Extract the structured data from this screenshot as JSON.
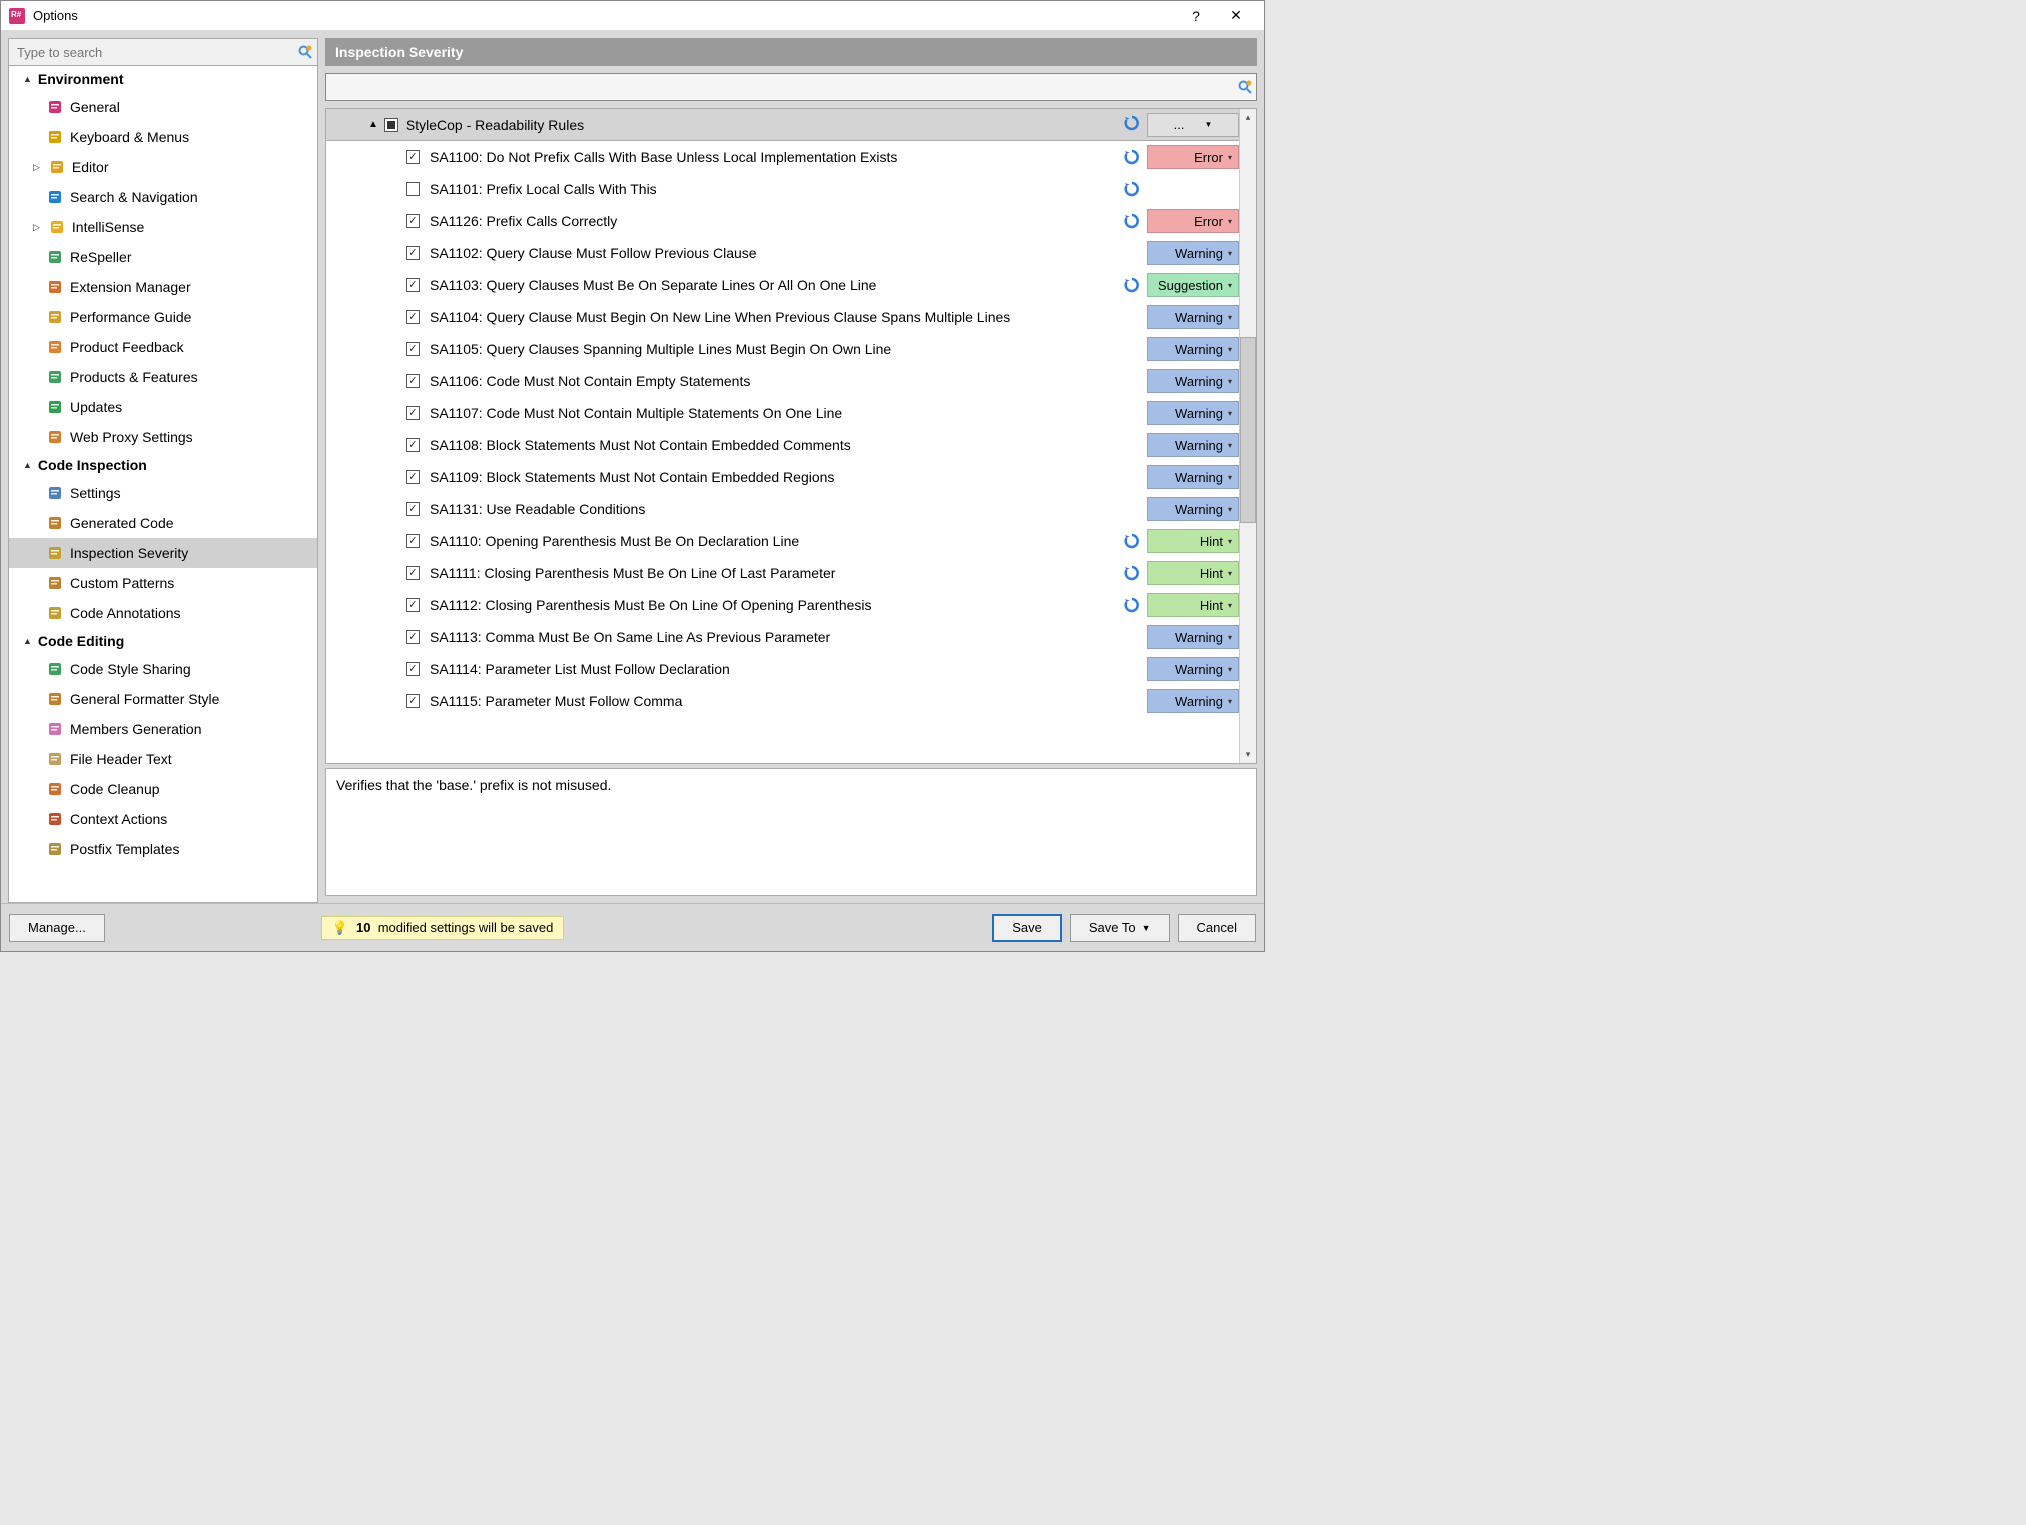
{
  "window": {
    "title": "Options"
  },
  "search_placeholder": "Type to search",
  "header": {
    "title": "Inspection Severity"
  },
  "nav": {
    "sections": [
      {
        "label": "Environment",
        "items": [
          {
            "label": "General",
            "icon": "app",
            "expand": false
          },
          {
            "label": "Keyboard & Menus",
            "icon": "kbd",
            "expand": false
          },
          {
            "label": "Editor",
            "icon": "pencil",
            "expand": true
          },
          {
            "label": "Search & Navigation",
            "icon": "search",
            "expand": false
          },
          {
            "label": "IntelliSense",
            "icon": "bulb",
            "expand": true
          },
          {
            "label": "ReSpeller",
            "icon": "spell",
            "expand": false
          },
          {
            "label": "Extension Manager",
            "icon": "ext",
            "expand": false
          },
          {
            "label": "Performance Guide",
            "icon": "perf",
            "expand": false
          },
          {
            "label": "Product Feedback",
            "icon": "mail",
            "expand": false
          },
          {
            "label": "Products & Features",
            "icon": "prod",
            "expand": false
          },
          {
            "label": "Updates",
            "icon": "upd",
            "expand": false
          },
          {
            "label": "Web Proxy Settings",
            "icon": "proxy",
            "expand": false
          }
        ]
      },
      {
        "label": "Code Inspection",
        "items": [
          {
            "label": "Settings",
            "icon": "settings",
            "expand": false
          },
          {
            "label": "Generated Code",
            "icon": "gen",
            "expand": false
          },
          {
            "label": "Inspection Severity",
            "icon": "insp",
            "expand": false,
            "selected": true
          },
          {
            "label": "Custom Patterns",
            "icon": "pat",
            "expand": false
          },
          {
            "label": "Code Annotations",
            "icon": "annot",
            "expand": false
          }
        ]
      },
      {
        "label": "Code Editing",
        "items": [
          {
            "label": "Code Style Sharing",
            "icon": "share",
            "expand": false
          },
          {
            "label": "General Formatter Style",
            "icon": "fmt",
            "expand": false
          },
          {
            "label": "Members Generation",
            "icon": "mem",
            "expand": false
          },
          {
            "label": "File Header Text",
            "icon": "file",
            "expand": false
          },
          {
            "label": "Code Cleanup",
            "icon": "clean",
            "expand": false
          },
          {
            "label": "Context Actions",
            "icon": "ctx",
            "expand": false
          },
          {
            "label": "Postfix Templates",
            "icon": "postfix",
            "expand": false
          }
        ]
      }
    ]
  },
  "ruleCategory": {
    "label": "StyleCop - Readability Rules",
    "menu_dots": "..."
  },
  "rules": [
    {
      "checked": true,
      "label": "SA1100: Do Not Prefix Calls With Base Unless Local Implementation Exists",
      "severity": "Error",
      "sevClass": "sev-error",
      "revert": true
    },
    {
      "checked": false,
      "label": "SA1101: Prefix Local Calls With This",
      "severity": "",
      "sevClass": "",
      "revert": true
    },
    {
      "checked": true,
      "label": "SA1126: Prefix Calls Correctly",
      "severity": "Error",
      "sevClass": "sev-error",
      "revert": true
    },
    {
      "checked": true,
      "label": "SA1102: Query Clause Must Follow Previous Clause",
      "severity": "Warning",
      "sevClass": "sev-warning",
      "revert": false
    },
    {
      "checked": true,
      "label": "SA1103: Query Clauses Must Be On Separate Lines Or All On One Line",
      "severity": "Suggestion",
      "sevClass": "sev-suggestion",
      "revert": true
    },
    {
      "checked": true,
      "label": "SA1104: Query Clause Must Begin On New Line When Previous Clause Spans Multiple Lines",
      "severity": "Warning",
      "sevClass": "sev-warning",
      "revert": false
    },
    {
      "checked": true,
      "label": "SA1105: Query Clauses Spanning Multiple Lines Must Begin On Own Line",
      "severity": "Warning",
      "sevClass": "sev-warning",
      "revert": false
    },
    {
      "checked": true,
      "label": "SA1106: Code Must Not Contain Empty Statements",
      "severity": "Warning",
      "sevClass": "sev-warning",
      "revert": false
    },
    {
      "checked": true,
      "label": "SA1107: Code Must Not Contain Multiple Statements On One Line",
      "severity": "Warning",
      "sevClass": "sev-warning",
      "revert": false
    },
    {
      "checked": true,
      "label": "SA1108: Block Statements Must Not Contain Embedded Comments",
      "severity": "Warning",
      "sevClass": "sev-warning",
      "revert": false
    },
    {
      "checked": true,
      "label": "SA1109: Block Statements Must Not Contain Embedded Regions",
      "severity": "Warning",
      "sevClass": "sev-warning",
      "revert": false
    },
    {
      "checked": true,
      "label": "SA1131: Use Readable Conditions",
      "severity": "Warning",
      "sevClass": "sev-warning",
      "revert": false
    },
    {
      "checked": true,
      "label": "SA1110: Opening Parenthesis Must Be On Declaration Line",
      "severity": "Hint",
      "sevClass": "sev-hint",
      "revert": true
    },
    {
      "checked": true,
      "label": "SA1111: Closing Parenthesis Must Be On Line Of Last Parameter",
      "severity": "Hint",
      "sevClass": "sev-hint",
      "revert": true
    },
    {
      "checked": true,
      "label": "SA1112: Closing Parenthesis Must Be On Line Of Opening Parenthesis",
      "severity": "Hint",
      "sevClass": "sev-hint",
      "revert": true
    },
    {
      "checked": true,
      "label": "SA1113: Comma Must Be On Same Line As Previous Parameter",
      "severity": "Warning",
      "sevClass": "sev-warning",
      "revert": false
    },
    {
      "checked": true,
      "label": "SA1114: Parameter List Must Follow Declaration",
      "severity": "Warning",
      "sevClass": "sev-warning",
      "revert": false
    },
    {
      "checked": true,
      "label": "SA1115: Parameter Must Follow Comma",
      "severity": "Warning",
      "sevClass": "sev-warning",
      "revert": false
    }
  ],
  "description": "Verifies that the 'base.' prefix is not misused.",
  "footer": {
    "manage": "Manage...",
    "status_count": "10",
    "status_text": "modified settings will be saved",
    "save": "Save",
    "saveTo": "Save To",
    "cancel": "Cancel"
  },
  "iconColors": {
    "app": "#d13476",
    "kbd": "#d7a000",
    "pencil": "#e0a020",
    "search": "#2080d0",
    "bulb": "#e8b020",
    "spell": "#40a060",
    "ext": "#d07030",
    "perf": "#d0a030",
    "mail": "#e08030",
    "prod": "#40a060",
    "upd": "#30a050",
    "proxy": "#d08030",
    "settings": "#5080c0",
    "gen": "#c08030",
    "insp": "#c0a030",
    "pat": "#c08030",
    "annot": "#c0a030",
    "share": "#40a060",
    "fmt": "#c08030",
    "mem": "#d070b0",
    "file": "#c0a060",
    "clean": "#d07030",
    "ctx": "#c05030",
    "postfix": "#b09040"
  }
}
